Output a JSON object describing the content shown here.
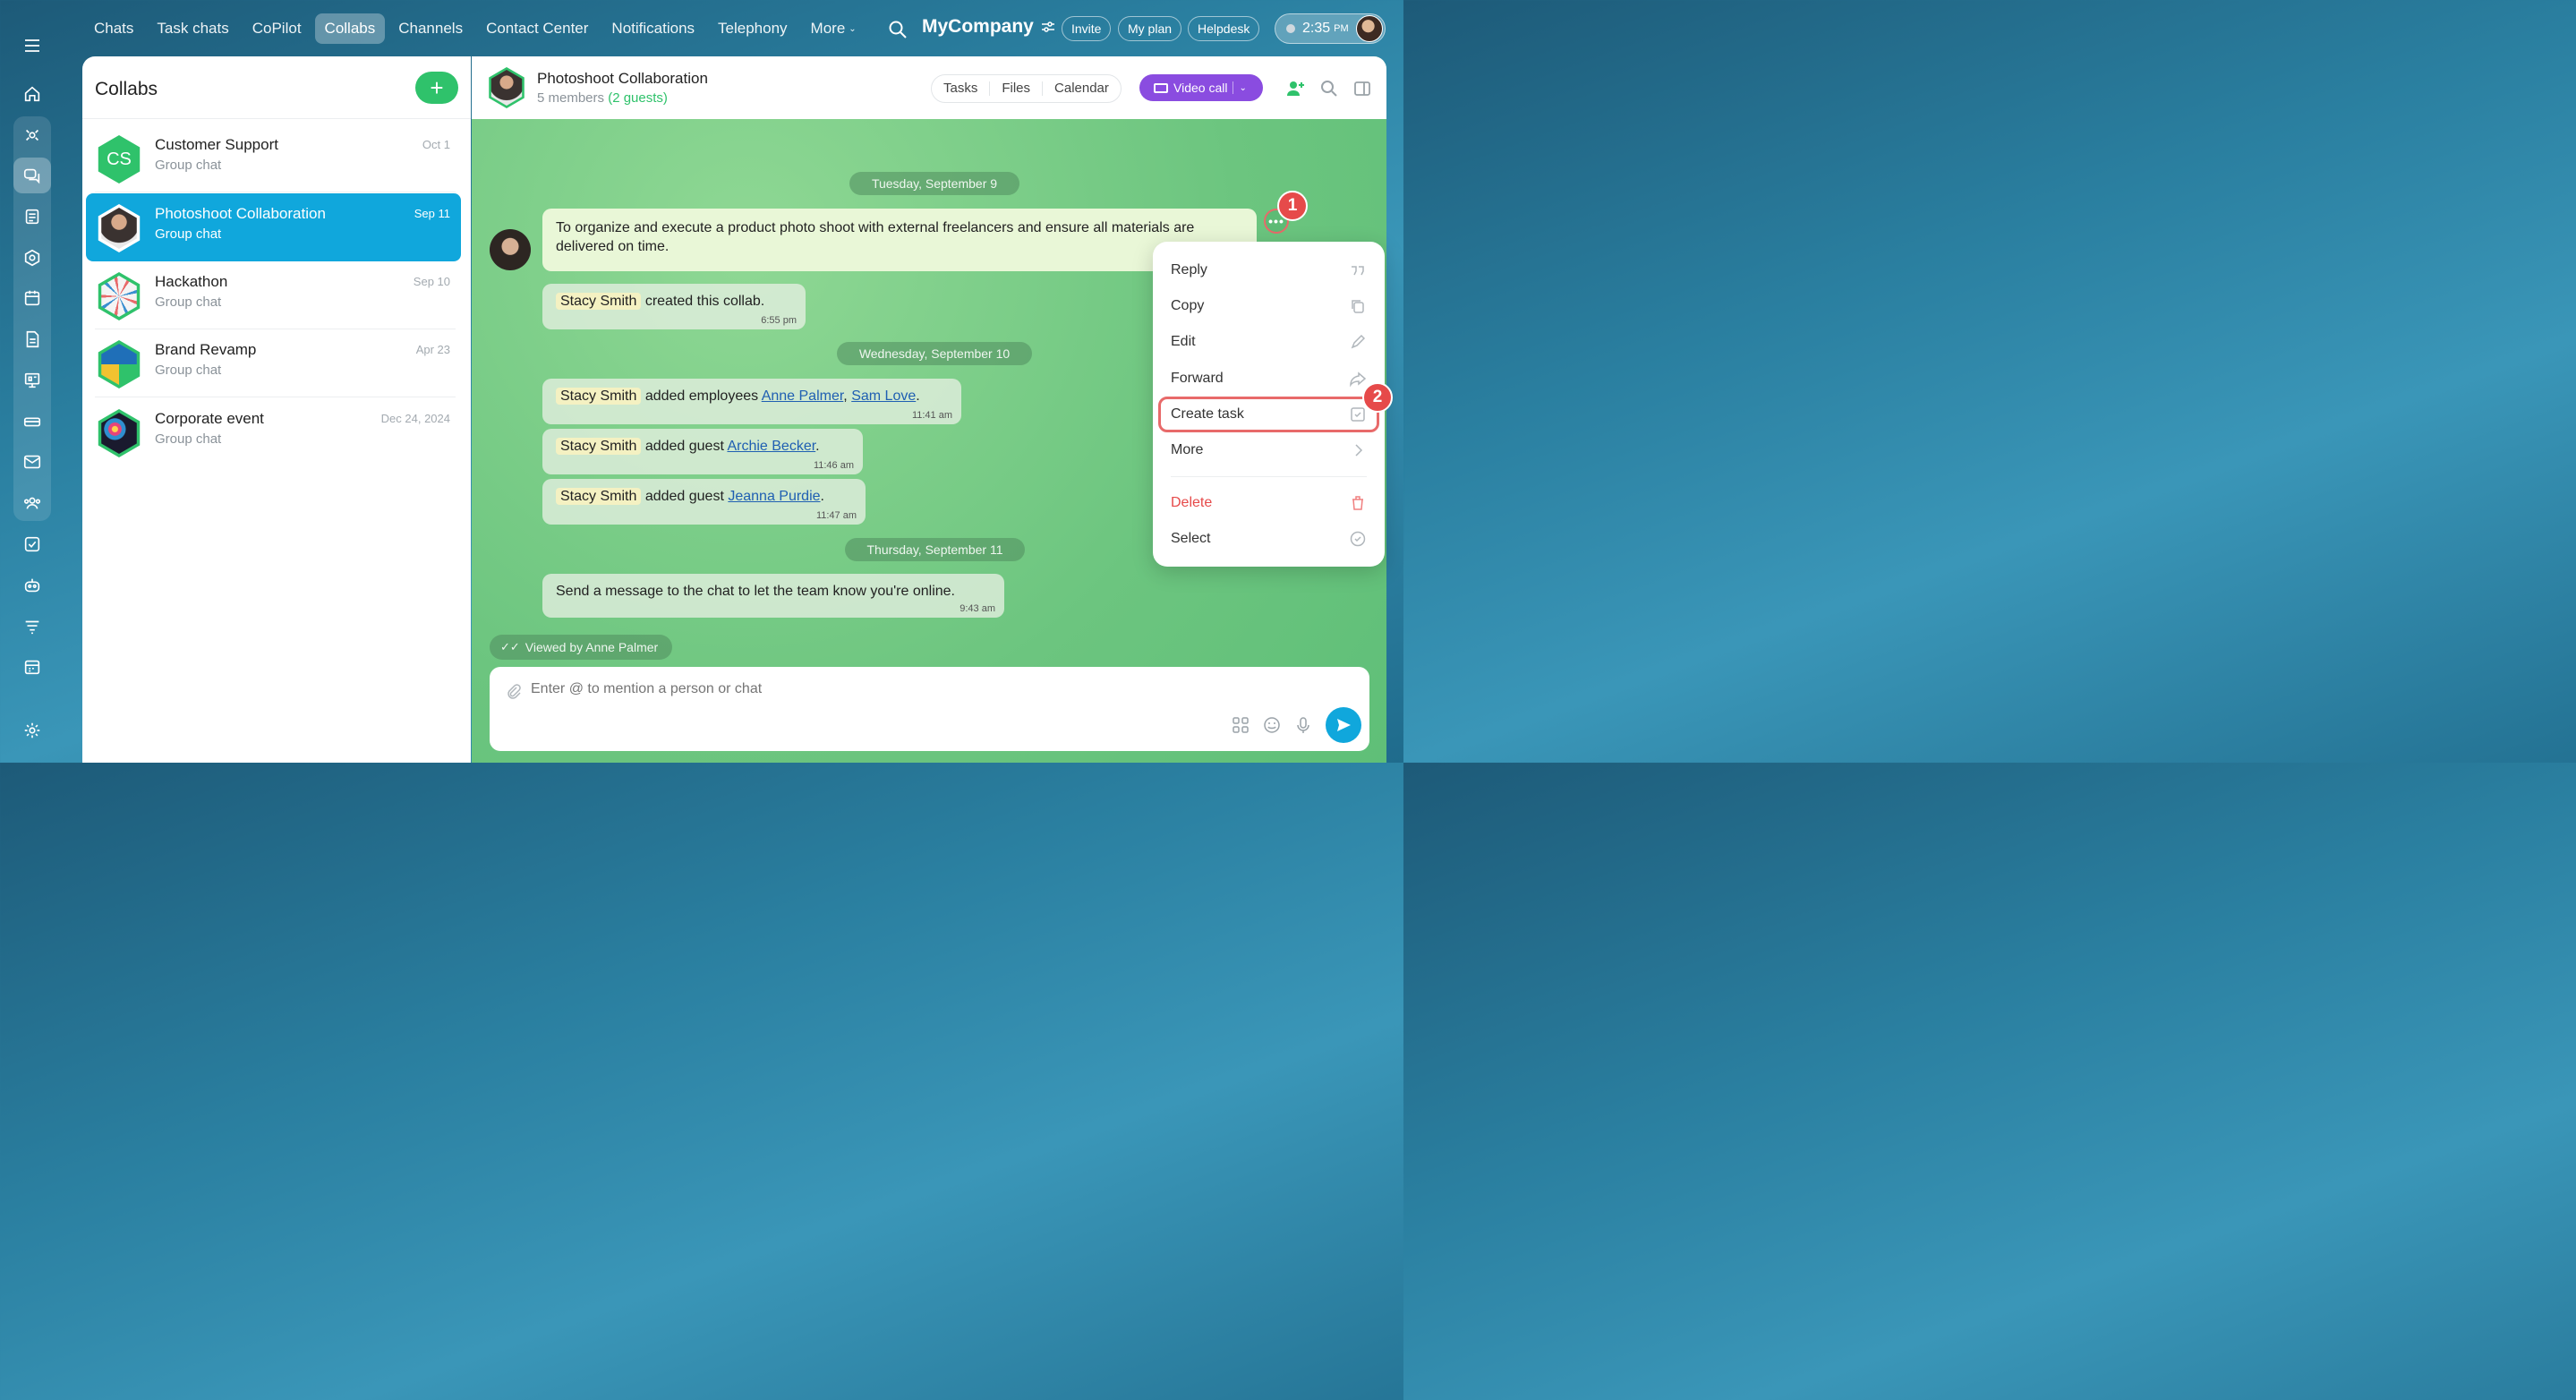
{
  "topnav": {
    "items": [
      "Chats",
      "Task chats",
      "CoPilot",
      "Collabs",
      "Channels",
      "Contact Center",
      "Notifications",
      "Telephony"
    ],
    "more": "More"
  },
  "brand": {
    "name": "MyCompany"
  },
  "actions": {
    "invite": "Invite",
    "plan": "My plan",
    "helpdesk": "Helpdesk"
  },
  "clock": {
    "time": "2:35",
    "ampm": "PM"
  },
  "collabs": {
    "title": "Collabs",
    "add_label": "+",
    "items": [
      {
        "name": "Customer Support",
        "sub": "Group chat",
        "date": "Oct 1",
        "initials": "CS"
      },
      {
        "name": "Photoshoot Collaboration",
        "sub": "Group chat",
        "date": "Sep 11"
      },
      {
        "name": "Hackathon",
        "sub": "Group chat",
        "date": "Sep 10"
      },
      {
        "name": "Brand Revamp",
        "sub": "Group chat",
        "date": "Apr 23"
      },
      {
        "name": "Corporate event",
        "sub": "Group chat",
        "date": "Dec 24, 2024"
      }
    ]
  },
  "chat": {
    "title": "Photoshoot Collaboration",
    "members": "5 members",
    "guests": "(2 guests)",
    "tabs": [
      "Tasks",
      "Files",
      "Calendar"
    ],
    "video_call": "Video call",
    "dates": [
      "Tuesday, September 9",
      "Wednesday, September 10",
      "Thursday, September 11"
    ],
    "pinned_text": "To organize and execute a product photo shoot with external freelancers and ensure all materials are delivered on time.",
    "messages": [
      {
        "who": "Stacy Smith",
        "text": "created this collab.",
        "time": "6:55 pm"
      },
      {
        "who": "Stacy Smith",
        "text": "added employees",
        "link1": "Anne Palmer",
        "sep": ",",
        "link2": "Sam Love",
        "end": ".",
        "time": "11:41 am"
      },
      {
        "who": "Stacy Smith",
        "text": "added guest",
        "link1": "Archie Becker",
        "end": ".",
        "time": "11:46 am"
      },
      {
        "who": "Stacy Smith",
        "text": "added guest",
        "link1": "Jeanna Purdie",
        "end": ".",
        "time": "11:47 am"
      },
      {
        "text": "Send a message to the chat to let the team know you're online.",
        "time": "9:43 am"
      }
    ],
    "viewed": "Viewed by Anne Palmer",
    "composer_placeholder": "Enter @ to mention a person or chat"
  },
  "menu": {
    "items": [
      "Reply",
      "Copy",
      "Edit",
      "Forward",
      "Create task",
      "More"
    ],
    "delete": "Delete",
    "select": "Select"
  },
  "steps": [
    "1",
    "2"
  ]
}
